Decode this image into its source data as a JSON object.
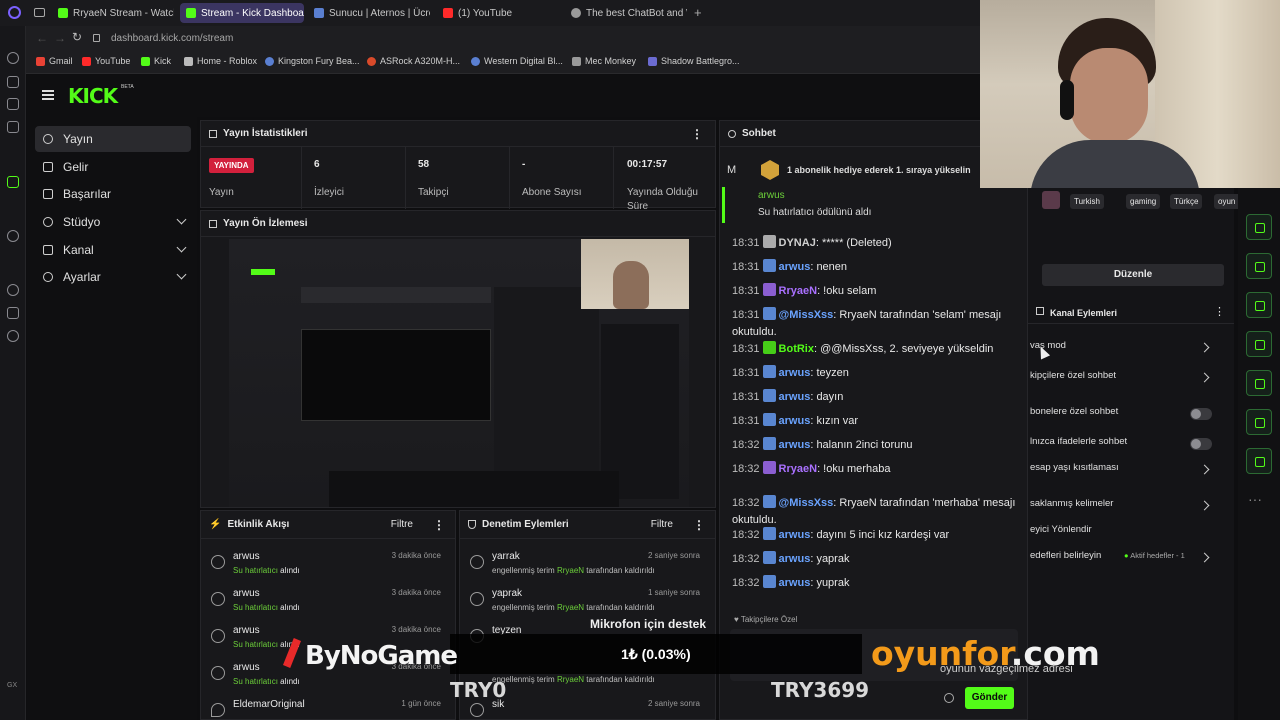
{
  "browser": {
    "tabs": [
      {
        "label": "RryaeN Stream - Watch Li"
      },
      {
        "label": "Stream - Kick Dashboard"
      },
      {
        "label": "Sunucu | Aternos | Ücret"
      },
      {
        "label": "(1) YouTube"
      },
      {
        "label": "The best ChatBot and W"
      }
    ],
    "url": "dashboard.kick.com/stream",
    "bookmarks": [
      "Gmail",
      "YouTube",
      "Kick",
      "Home - Roblox",
      "Kingston Fury Bea...",
      "ASRock A320M-H...",
      "Western Digital Bl...",
      "Mec Monkey",
      "Shadow Battlegro..."
    ]
  },
  "app": {
    "logo": "KICK",
    "logo_beta": "BETA",
    "nav": [
      {
        "label": "Yayın"
      },
      {
        "label": "Gelir"
      },
      {
        "label": "Başarılar"
      },
      {
        "label": "Stüdyo"
      },
      {
        "label": "Kanal"
      },
      {
        "label": "Ayarlar"
      }
    ]
  },
  "stats": {
    "title": "Yayın İstatistikleri",
    "live_badge": "YAYINDA",
    "live_label": "Yayın",
    "viewers": "6",
    "viewers_label": "İzleyici",
    "followers": "58",
    "followers_label": "Takipçi",
    "subs": "-",
    "subs_label": "Abone Sayısı",
    "uptime": "00:17:57",
    "uptime_label_1": "Yayında Olduğu",
    "uptime_label_2": "Süre"
  },
  "preview": {
    "title": "Yayın Ön İzlemesi"
  },
  "activity": {
    "title": "Etkinlik Akışı",
    "filter": "Filtre",
    "items": [
      {
        "name": "arwus",
        "sub": "Su hatırlatıcı",
        "sub2": "alındı",
        "time": "3 dakika önce"
      },
      {
        "name": "arwus",
        "sub": "Su hatırlatıcı",
        "sub2": "alındı",
        "time": "3 dakika önce"
      },
      {
        "name": "arwus",
        "sub": "Su hatırlatıcı",
        "sub2": "alındı",
        "time": "3 dakika önce"
      },
      {
        "name": "arwus",
        "sub": "Su hatırlatıcı",
        "sub2": "alındı",
        "time": "3 dakika önce"
      },
      {
        "name": "EldemarOriginal",
        "sub": "",
        "sub2": "",
        "time": "1 gün önce"
      }
    ]
  },
  "moderation": {
    "title": "Denetim Eylemleri",
    "filter": "Filtre",
    "items": [
      {
        "word": "yarrak",
        "pre": "engellenmiş terim",
        "user": "RryaeN",
        "post": "tarafından kaldırıldı",
        "time": "2 saniye sonra"
      },
      {
        "word": "yaprak",
        "pre": "engellenmiş terim",
        "user": "RryaeN",
        "post": "tarafından kaldırıldı",
        "time": "1 saniye sonra"
      },
      {
        "word": "teyzen",
        "pre": "",
        "user": "",
        "post": "",
        "time": ""
      },
      {
        "word": "",
        "pre": "engellenmiş terim",
        "user": "RryaeN",
        "post": "tarafından kaldırıldı",
        "time": ""
      },
      {
        "word": "sik",
        "pre": "",
        "user": "",
        "post": "",
        "time": "2 saniye sonra"
      }
    ]
  },
  "chat": {
    "title": "Sohbet",
    "pinned_user_initial": "M",
    "pinned_text": "1 abonelik hediye ederek 1. sıraya yükselin",
    "reward_user": "arwus",
    "reward_text": "Su hatırlatıcı ödülünü aldı",
    "messages": [
      {
        "time": "18:31",
        "user": "DYNAJ",
        "text": ": ***** (Deleted)",
        "color": "#cfcfcf"
      },
      {
        "time": "18:31",
        "user": "arwus",
        "text": ": nenen",
        "color": "#6aa3ff"
      },
      {
        "time": "18:31",
        "user": "RryaeN",
        "text": ": !oku selam",
        "color": "#a970ff"
      },
      {
        "time": "18:31",
        "user": "@MissXss",
        "text": ": RryaeN tarafından 'selam' mesajı okutuldu.",
        "color": "#6aa3ff"
      },
      {
        "time": "18:31",
        "user": "BotRix",
        "text": ": @@MissXss, 2. seviyeye yükseldin",
        "color": "#53fc18"
      },
      {
        "time": "18:31",
        "user": "arwus",
        "text": ": teyzen",
        "color": "#6aa3ff"
      },
      {
        "time": "18:31",
        "user": "arwus",
        "text": ": dayın",
        "color": "#6aa3ff"
      },
      {
        "time": "18:31",
        "user": "arwus",
        "text": ": kızın var",
        "color": "#6aa3ff"
      },
      {
        "time": "18:32",
        "user": "arwus",
        "text": ": halanın 2inci torunu",
        "color": "#6aa3ff"
      },
      {
        "time": "18:32",
        "user": "RryaeN",
        "text": ": !oku merhaba",
        "color": "#a970ff"
      },
      {
        "time": "18:32",
        "user": "@MissXss",
        "text": ": RryaeN tarafından 'merhaba' mesajı okutuldu.",
        "color": "#6aa3ff"
      },
      {
        "time": "18:32",
        "user": "arwus",
        "text": ": dayını 5 inci kız kardeşi var",
        "color": "#6aa3ff"
      },
      {
        "time": "18:32",
        "user": "arwus",
        "text": ": yaprak",
        "color": "#6aa3ff"
      },
      {
        "time": "18:32",
        "user": "arwus",
        "text": ": yuprak",
        "color": "#6aa3ff"
      }
    ],
    "followers_only": "Takipçilere Özel",
    "send": "Gönder"
  },
  "channel": {
    "tags": [
      "Turkish",
      "gaming",
      "Türkçe",
      "oyun"
    ],
    "edit": "Düzenle",
    "actions_title": "Kanal Eylemleri",
    "actions": [
      {
        "label": "vaş mod",
        "kind": "chevron"
      },
      {
        "label": "kipçilere özel sohbet",
        "kind": "chevron"
      },
      {
        "label": "bonelere özel sohbet",
        "kind": "toggle"
      },
      {
        "label": "lnızca ifadelerle sohbet",
        "kind": "toggle"
      },
      {
        "label": "esap yaşı kısıtlaması",
        "kind": "chevron"
      },
      {
        "label": "saklanmış kelimeler",
        "kind": "chevron"
      },
      {
        "label": "eyici Yönlendir",
        "kind": "none"
      },
      {
        "label": "edefleri belirleyin",
        "kind": "chevron"
      }
    ],
    "goal_note": "Aktif hedefler - 1"
  },
  "overlay": {
    "brand_left": "ByNoGame",
    "brand_right": "oyunfor",
    "brand_right_tld": ".com",
    "brand_right_sub": "oyunun vazgeçilmez adresi",
    "donation_title": "Mikrofon için destek",
    "donation_amount": "1₺ (0.03%)",
    "code_left": "TRY0",
    "code_right": "TRY3699"
  }
}
